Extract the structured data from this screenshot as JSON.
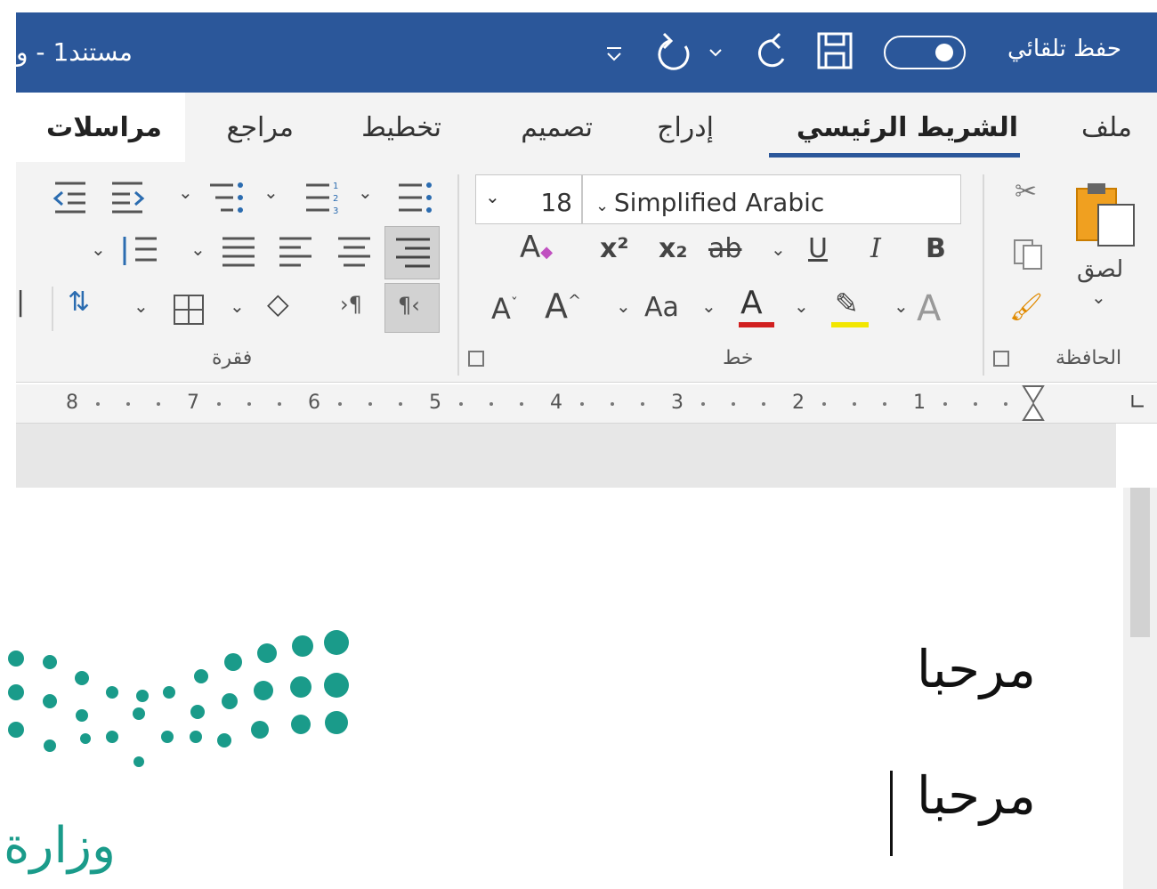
{
  "titlebar": {
    "autosave_label": "حفظ تلقائي",
    "doc_title": "مستند1 - و",
    "icons": [
      "toggle",
      "save-icon",
      "redo-icon",
      "undo-icon",
      "customize-icon"
    ]
  },
  "tabs": [
    {
      "label": "ملف",
      "active": false
    },
    {
      "label": "الشريط الرئيسي",
      "active": true
    },
    {
      "label": "إدراج",
      "active": false
    },
    {
      "label": "تصميم",
      "active": false
    },
    {
      "label": "تخطيط",
      "active": false
    },
    {
      "label": "مراجع",
      "active": false
    },
    {
      "label": "مراسلات",
      "active": false
    }
  ],
  "ribbon": {
    "clipboard": {
      "label": "الحافظة",
      "paste_label": "لصق"
    },
    "font": {
      "label": "خط",
      "font_name": "Simplified Arabic",
      "font_size": "18",
      "buttons": {
        "bold": "B",
        "italic": "I",
        "underline": "U",
        "strike": "ab",
        "subscript": "x₂",
        "superscript": "x²",
        "change_case": "Aa"
      },
      "font_color": "#d11f1f",
      "highlight_color": "#f2e600"
    },
    "paragraph": {
      "label": "فقرة"
    }
  },
  "ruler": {
    "numbers": [
      "8",
      "7",
      "6",
      "5",
      "4",
      "3",
      "2",
      "1"
    ]
  },
  "document": {
    "lines": [
      "مرحبا",
      "مرحبا"
    ],
    "logo_text": "وزارة",
    "logo_color": "#1a9b8a"
  }
}
